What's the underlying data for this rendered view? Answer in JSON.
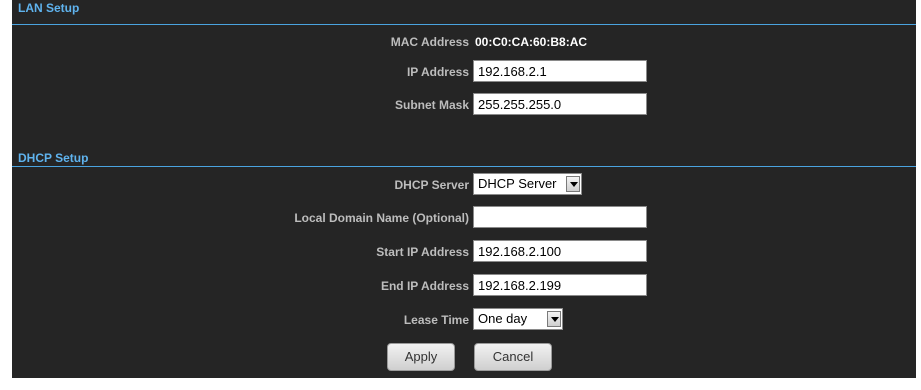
{
  "lan": {
    "title": "LAN Setup",
    "mac_label": "MAC Address",
    "mac_value": "00:C0:CA:60:B8:AC",
    "ip_label": "IP Address",
    "ip_value": "192.168.2.1",
    "subnet_label": "Subnet Mask",
    "subnet_value": "255.255.255.0"
  },
  "dhcp": {
    "title": "DHCP Setup",
    "server_label": "DHCP Server",
    "server_selected": "DHCP Server",
    "domain_label": "Local Domain Name (Optional)",
    "domain_value": "",
    "start_label": "Start IP Address",
    "start_value": "192.168.2.100",
    "end_label": "End IP Address",
    "end_value": "192.168.2.199",
    "lease_label": "Lease Time",
    "lease_selected": "One day"
  },
  "buttons": {
    "apply": "Apply",
    "cancel": "Cancel"
  },
  "colors": {
    "panel_bg": "#252525",
    "section_title": "#5fb3ee",
    "section_rule": "#4aa3df",
    "label": "#bdbdbd",
    "value": "#ffffff"
  },
  "icons": {
    "dropdown": "chevron-down-icon"
  }
}
